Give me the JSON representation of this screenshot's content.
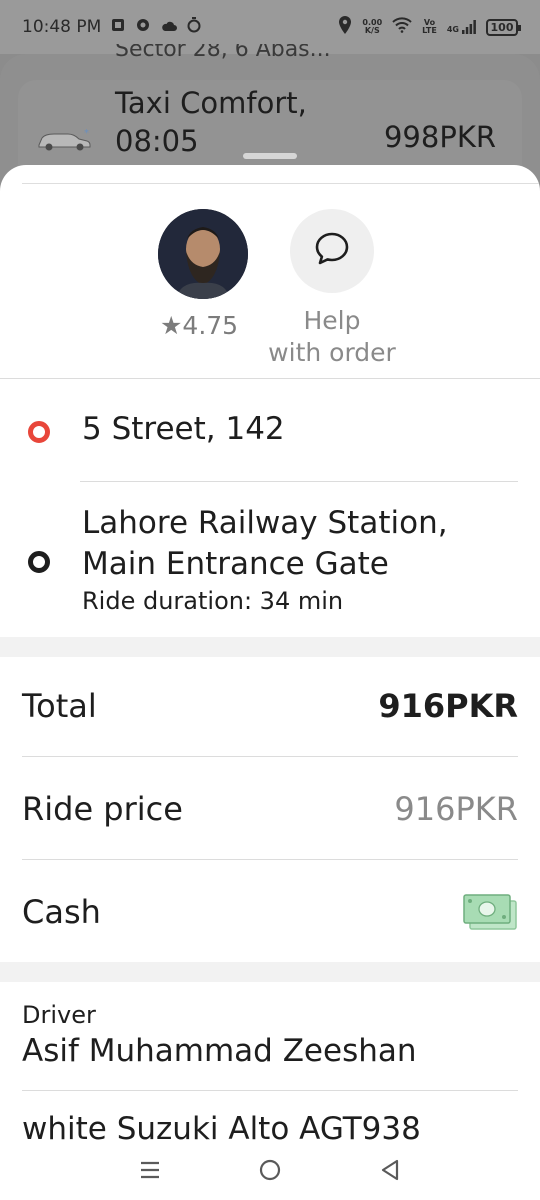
{
  "status_bar": {
    "time": "10:48 PM",
    "net_speed_value": "0.00",
    "net_speed_unit": "K/S",
    "volte_top": "Vo",
    "volte_bottom": "LTE",
    "network": "4G",
    "battery": "100"
  },
  "order_card": {
    "address": "Sector 28, 6 Abas...",
    "title_line1": "Taxi Comfort,",
    "title_line2": "08:05",
    "price": "998PKR"
  },
  "driver": {
    "rating": "★4.75"
  },
  "help": {
    "line1": "Help",
    "line2": "with order"
  },
  "route": {
    "pickup": "5 Street, 142",
    "destination_line1": "Lahore Railway Station,",
    "destination_line2": "Main Entrance Gate",
    "duration": "Ride duration: 34 min"
  },
  "payment": {
    "total_label": "Total",
    "total_value": "916PKR",
    "ride_price_label": "Ride price",
    "ride_price_value": "916PKR",
    "method_label": "Cash"
  },
  "driver_info": {
    "label": "Driver",
    "name": "Asif Muhammad Zeeshan",
    "car": "white Suzuki Alto AGT938"
  },
  "colors": {
    "pickup_dot": "#e8463a",
    "destination_dot": "#1e1e1e",
    "cash_icon": "#8fd3a0"
  }
}
